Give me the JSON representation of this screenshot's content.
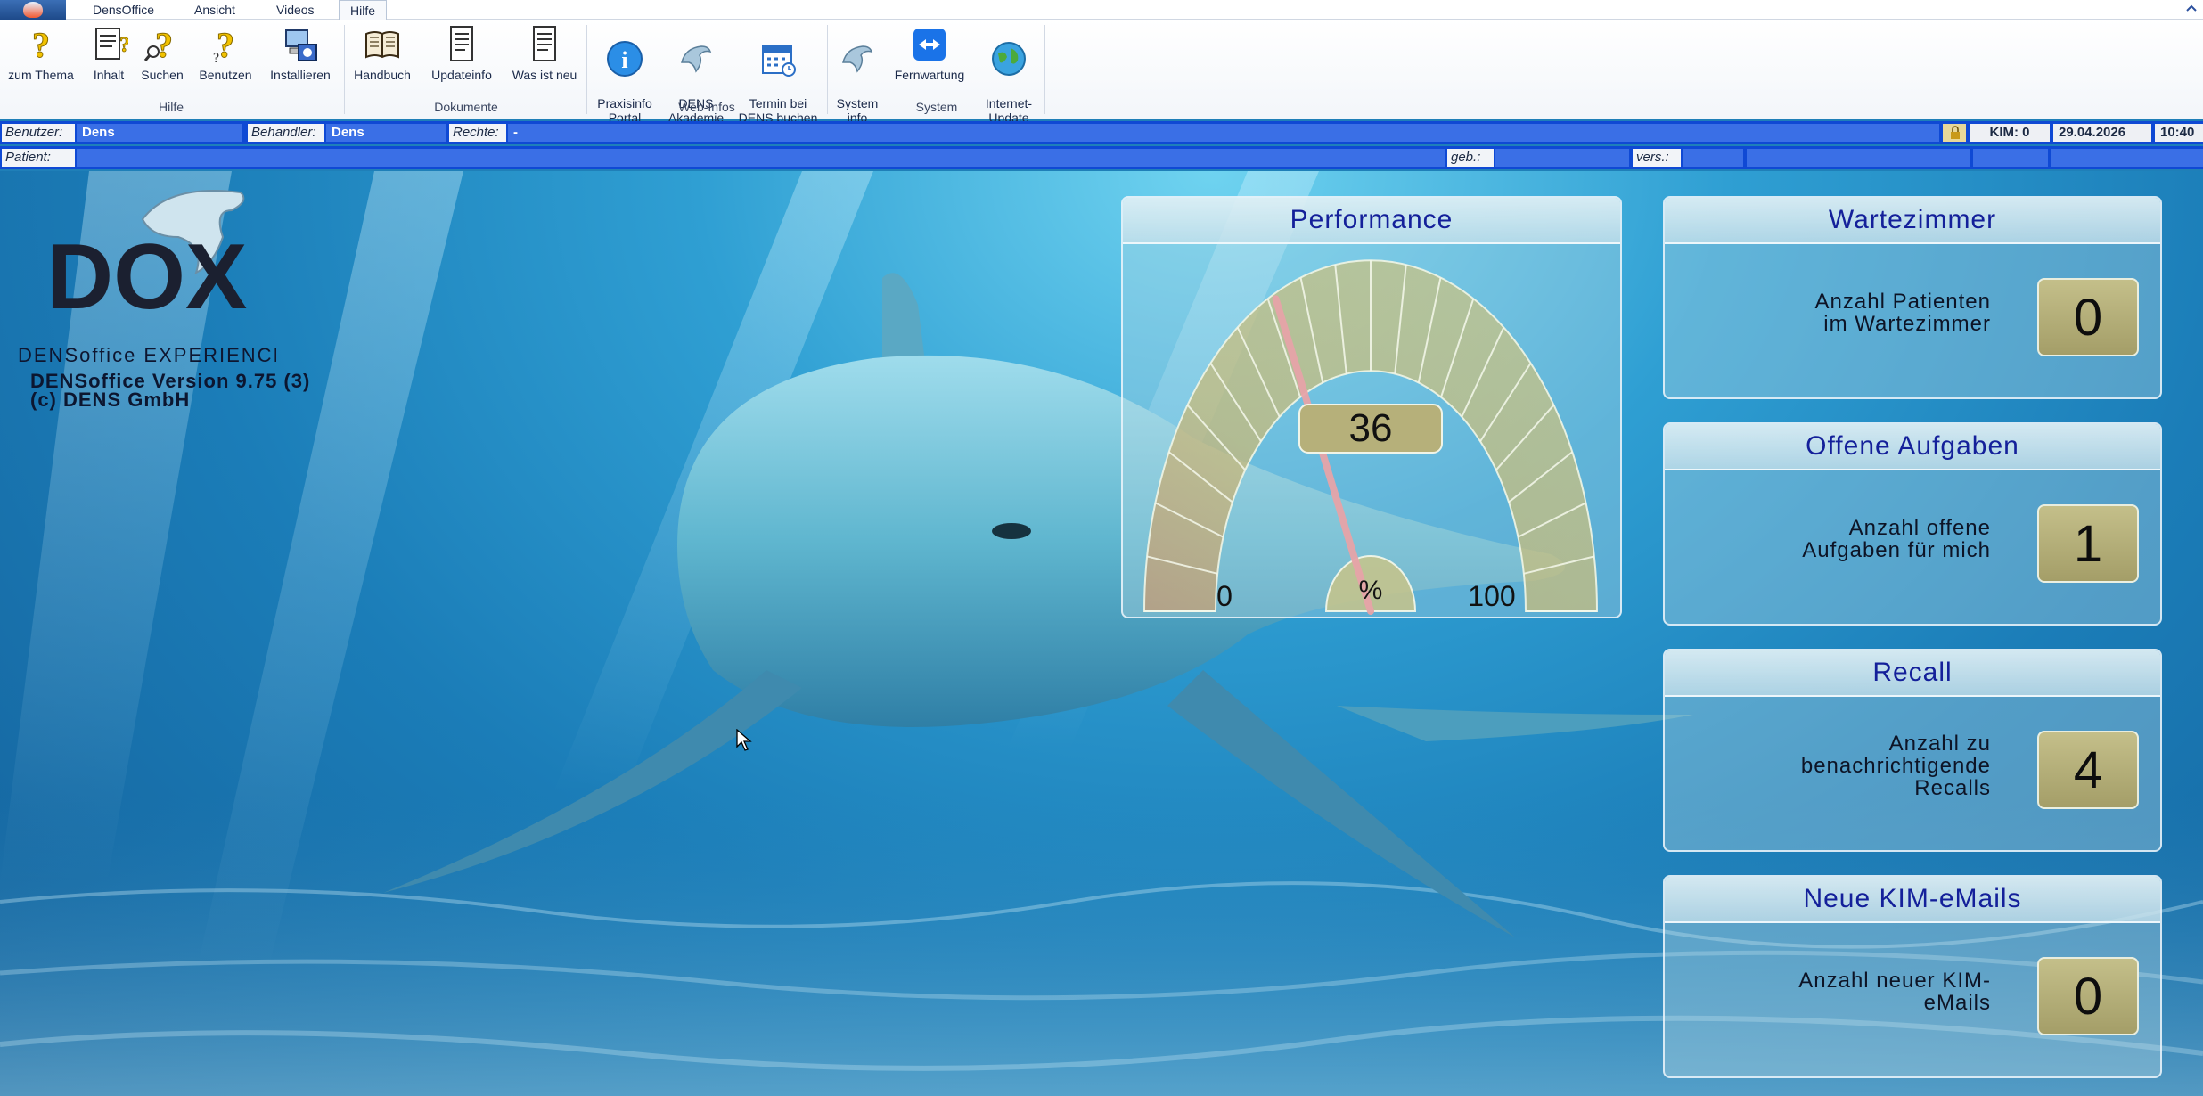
{
  "menu": {
    "tabs": [
      "DensOffice",
      "Ansicht",
      "Videos",
      "Hilfe"
    ],
    "active_tab": "Hilfe"
  },
  "ribbon": {
    "groups": {
      "hilfe": {
        "label": "Hilfe",
        "buttons": [
          "zum Thema",
          "Inhalt",
          "Suchen",
          "Benutzen",
          "Installieren"
        ]
      },
      "dokumente": {
        "label": "Dokumente",
        "buttons": [
          "Handbuch",
          "Updateinfo",
          "Was ist neu"
        ]
      },
      "webinfos": {
        "label": "Web-Infos",
        "buttons": [
          "Praxisinfo\nPortal",
          "DENS\nAkademie",
          "Termin bei\nDENS buchen"
        ]
      },
      "system": {
        "label": "System",
        "buttons": [
          "System\ninfo",
          "Fernwartung",
          "Internet-\nUpdate"
        ]
      }
    }
  },
  "status": {
    "benutzer_label": "Benutzer:",
    "benutzer": "Dens",
    "behandler_label": "Behandler:",
    "behandler": "Dens",
    "rechte_label": "Rechte:",
    "rechte": "-",
    "kim": "KIM: 0",
    "date": "29.04.2026",
    "time": "10:40"
  },
  "patient_bar": {
    "patient_label": "Patient:",
    "geb_label": "geb.:",
    "vers_label": "vers.:"
  },
  "logo": {
    "wordmark": "DOX",
    "tagline": "DENSoffice EXPERIENCED"
  },
  "version": {
    "line1": "DENSoffice Version 9.75 (3)",
    "line2": "(c) DENS GmbH"
  },
  "performance": {
    "title": "Performance",
    "value": 36,
    "unit": "%",
    "min_label": "0",
    "max_label": "100"
  },
  "panels": {
    "wartezimmer": {
      "title": "Wartezimmer",
      "text": [
        "Anzahl Patienten",
        "im Wartezimmer"
      ],
      "count": "0"
    },
    "aufgaben": {
      "title": "Offene Aufgaben",
      "text": [
        "Anzahl offene",
        "Aufgaben für mich"
      ],
      "count": "1"
    },
    "recall": {
      "title": "Recall",
      "text": [
        "Anzahl zu",
        "benachrichtigende",
        "Recalls"
      ],
      "count": "4"
    },
    "kim": {
      "title": "Neue KIM-eMails",
      "text": [
        "Anzahl neuer KIM-",
        "eMails"
      ],
      "count": "0"
    }
  },
  "colors": {
    "status_bar": "#0f49d4",
    "panel_title": "#14209a",
    "counter": "#b6b07a",
    "gauge_needle": "#e6a3a8"
  },
  "icons": {
    "zum_thema": "question-icon",
    "inhalt": "contents-icon",
    "suchen": "search-question-icon",
    "benutzen": "usage-question-icon",
    "installieren": "install-icon",
    "handbuch": "book-icon",
    "updateinfo": "document-icon",
    "was_ist_neu": "document-icon",
    "praxisinfo": "info-icon",
    "akademie": "dolphin-icon",
    "termin": "calendar-icon",
    "systeminfo": "dolphin-icon",
    "fernwartung": "remote-icon",
    "update": "globe-icon"
  }
}
